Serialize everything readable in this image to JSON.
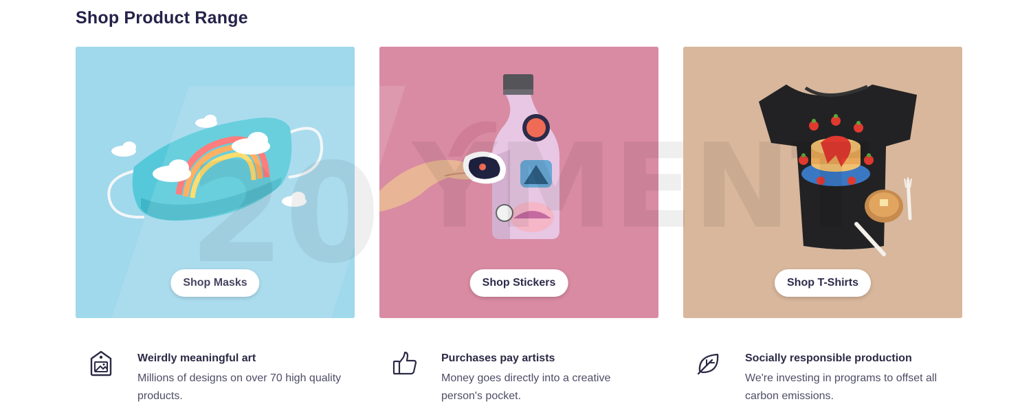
{
  "section": {
    "title": "Shop Product Range"
  },
  "cards": [
    {
      "button": "Shop Masks",
      "bg": "#a0d8ec"
    },
    {
      "button": "Shop Stickers",
      "bg": "#d98ba3"
    },
    {
      "button": "Shop T-Shirts",
      "bg": "#d8b79c"
    }
  ],
  "features": [
    {
      "icon": "image-tag-icon",
      "title": "Weirdly meaningful art",
      "desc": "Millions of designs on over 70 high quality products."
    },
    {
      "icon": "thumbs-up-icon",
      "title": "Purchases pay artists",
      "desc": "Money goes directly into a creative person's pocket."
    },
    {
      "icon": "leaf-icon",
      "title": "Socially responsible production",
      "desc": "We're investing in programs to offset all carbon emissions."
    }
  ]
}
